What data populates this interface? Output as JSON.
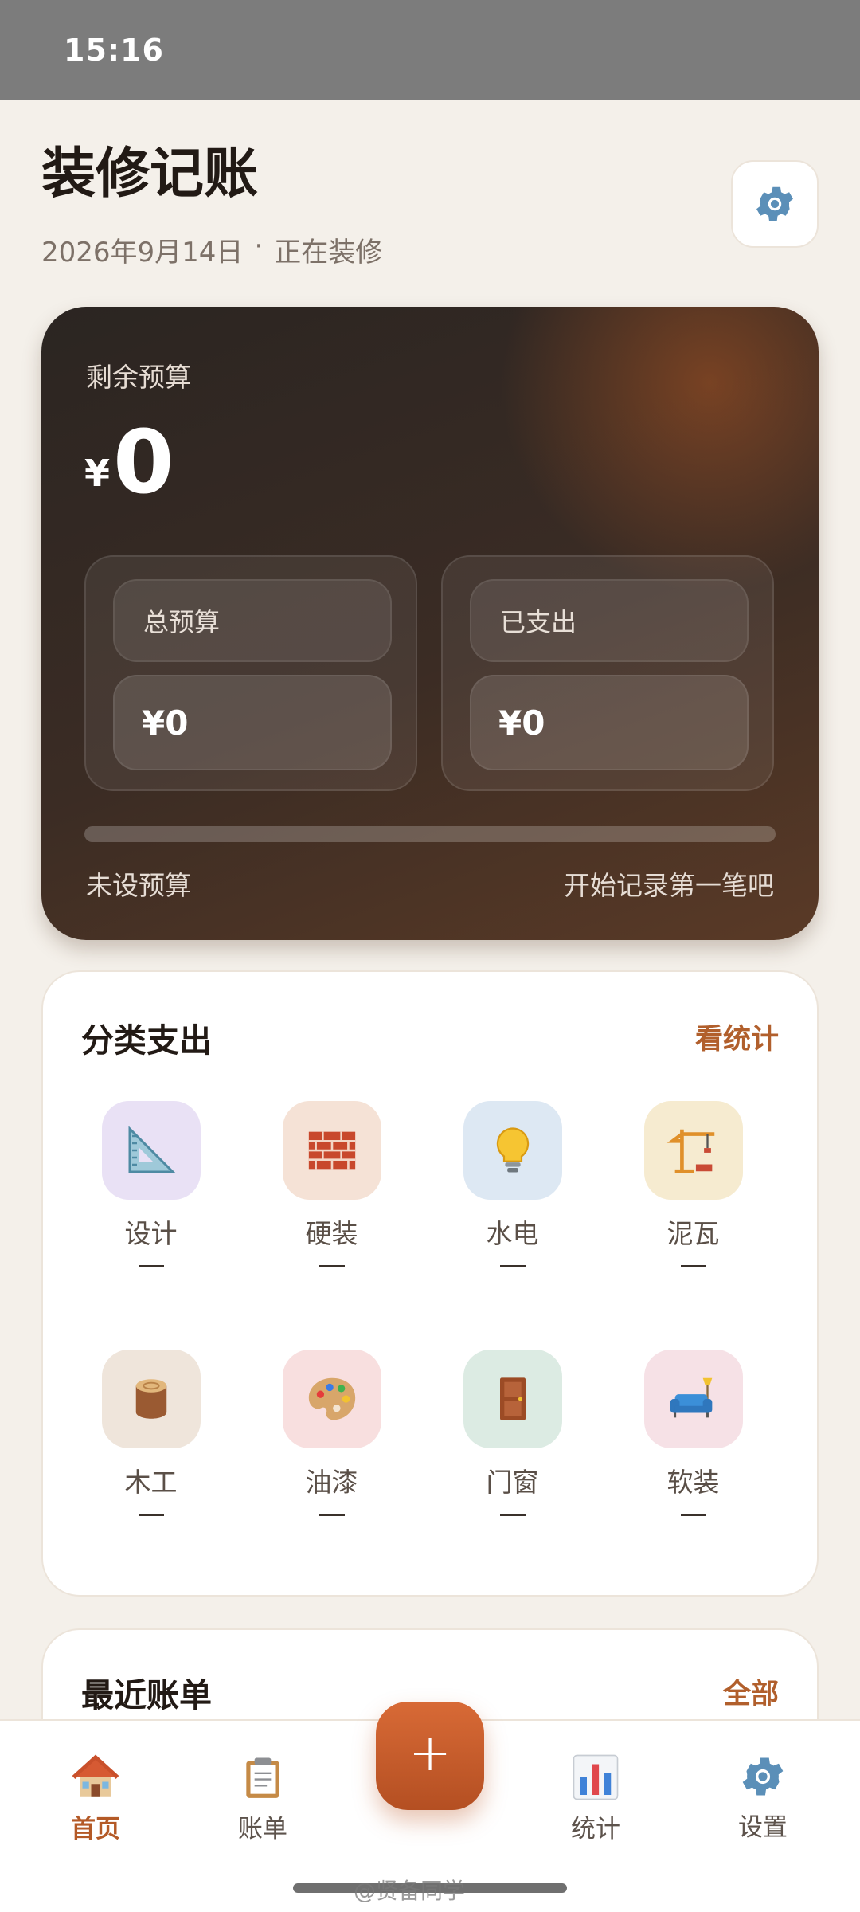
{
  "status_bar": {
    "time": "15:16"
  },
  "header": {
    "title": "装修记账",
    "date": "2026年9月14日",
    "separator": "·",
    "status": "正在装修"
  },
  "budget": {
    "remaining_label": "剩余预算",
    "currency": "¥",
    "remaining_value": "0",
    "total_label": "总预算",
    "total_value": "¥0",
    "spent_label": "已支出",
    "spent_value": "¥0",
    "progress_percent": 0,
    "footer_left": "未设预算",
    "footer_right": "开始记录第一笔吧"
  },
  "categories": {
    "title": "分类支出",
    "link": "看统计",
    "items": [
      {
        "name": "设计",
        "amount": "—",
        "icon": "triangle-ruler-icon",
        "bg": "#e9e1f5"
      },
      {
        "name": "硬装",
        "amount": "—",
        "icon": "brick-icon",
        "bg": "#f5e2d6"
      },
      {
        "name": "水电",
        "amount": "—",
        "icon": "light-bulb-icon",
        "bg": "#dde8f3"
      },
      {
        "name": "泥瓦",
        "amount": "—",
        "icon": "crane-icon",
        "bg": "#f6ebd0"
      },
      {
        "name": "木工",
        "amount": "—",
        "icon": "wood-log-icon",
        "bg": "#efe5db"
      },
      {
        "name": "油漆",
        "amount": "—",
        "icon": "paint-palette-icon",
        "bg": "#f8dfdf"
      },
      {
        "name": "门窗",
        "amount": "—",
        "icon": "door-icon",
        "bg": "#dcebe3"
      },
      {
        "name": "软装",
        "amount": "—",
        "icon": "sofa-icon",
        "bg": "#f6e1e6"
      }
    ]
  },
  "recent": {
    "title": "最近账单",
    "link": "全部"
  },
  "nav": {
    "items": [
      {
        "label": "首页",
        "icon": "house-icon",
        "active": true
      },
      {
        "label": "账单",
        "icon": "clipboard-icon",
        "active": false
      },
      {
        "label": "统计",
        "icon": "bar-chart-icon",
        "active": false
      },
      {
        "label": "设置",
        "icon": "gear-icon",
        "active": false
      }
    ],
    "fab_label": "+"
  },
  "watermark": "@贤备同学",
  "colors": {
    "accent": "#b45a27",
    "card_dark": "#3b2c24",
    "page_bg": "#f4f0ea"
  }
}
